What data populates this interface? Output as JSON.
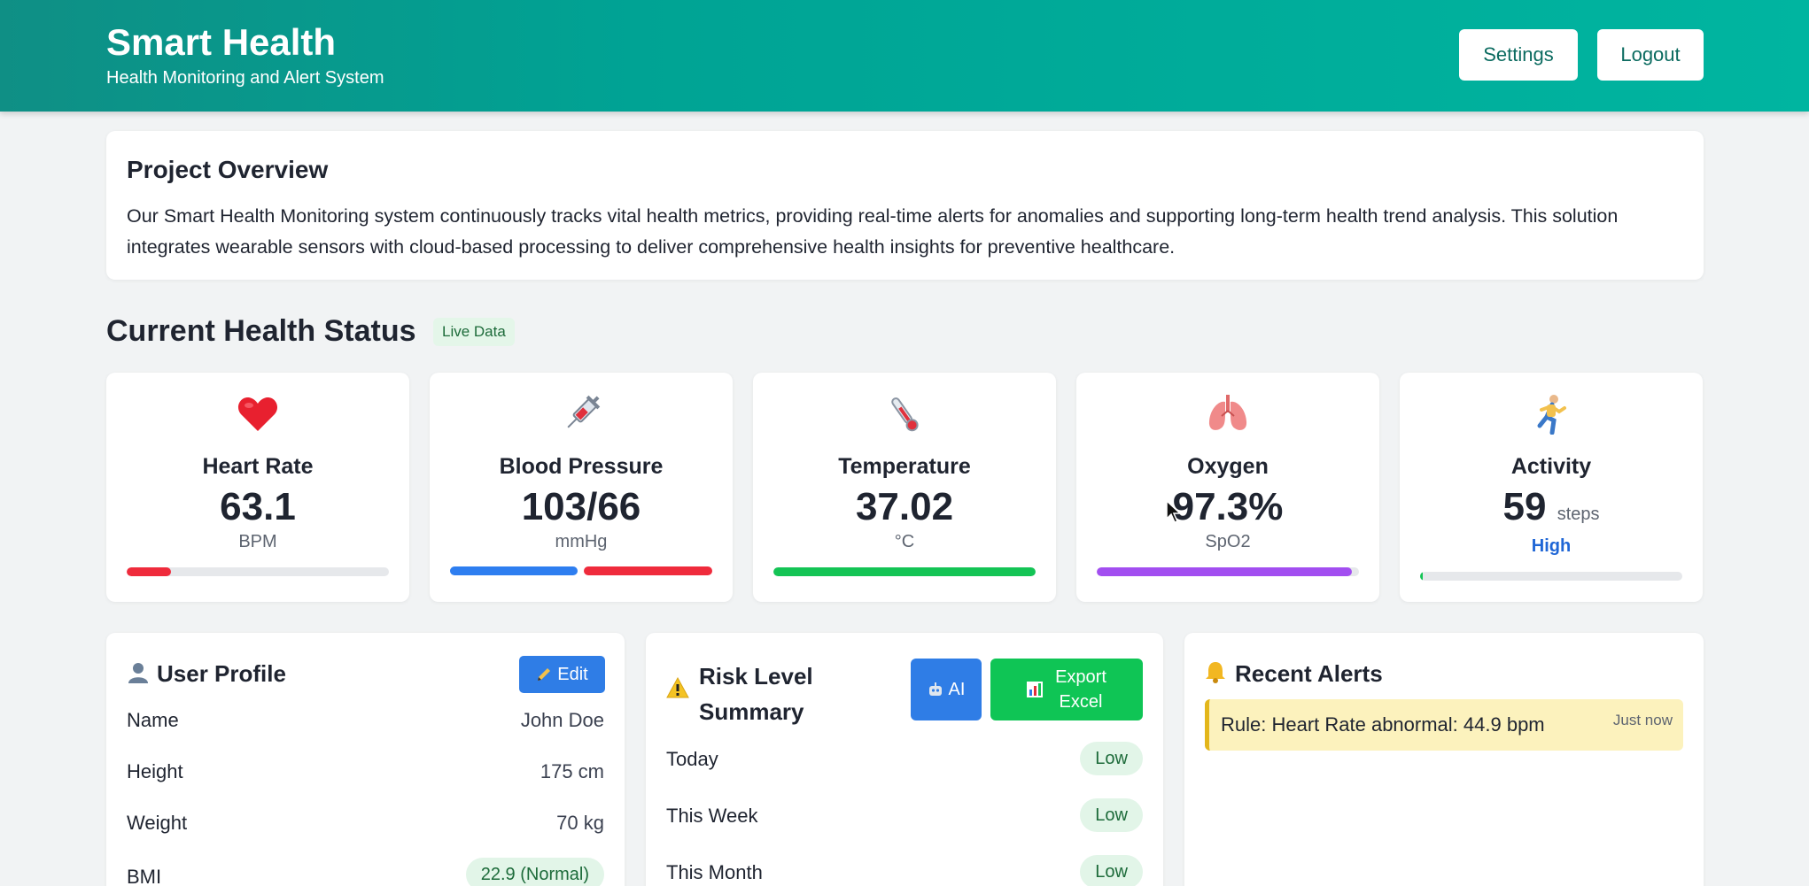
{
  "header": {
    "title": "Smart Health",
    "subtitle": "Health Monitoring and Alert System",
    "settings_label": "Settings",
    "logout_label": "Logout"
  },
  "overview": {
    "title": "Project Overview",
    "body": "Our Smart Health Monitoring system continuously tracks vital health metrics, providing real-time alerts for anomalies and supporting long-term health trend analysis. This solution integrates wearable sensors with cloud-based processing to deliver comprehensive health insights for preventive healthcare."
  },
  "status": {
    "title": "Current Health Status",
    "badge": "Live Data"
  },
  "metrics": [
    {
      "label": "Heart Rate",
      "value": "63.1",
      "unit": "BPM",
      "icon": "heart-icon",
      "bar_fraction": 0.17,
      "bar_color": "#ef2b3c"
    },
    {
      "label": "Blood Pressure",
      "value": "103/66",
      "unit": "mmHg",
      "icon": "syringe-icon",
      "bar_colors": [
        "#2e7ef0",
        "#ef2b3c"
      ]
    },
    {
      "label": "Temperature",
      "value": "37.02",
      "unit": "°C",
      "icon": "thermometer-icon",
      "bar_fraction": 1.0,
      "bar_color": "#14c455"
    },
    {
      "label": "Oxygen",
      "value": "97.3%",
      "unit": "SpO2",
      "icon": "lungs-icon",
      "bar_fraction": 0.973,
      "bar_color": "#a24ef0"
    },
    {
      "label": "Activity",
      "value": "59",
      "unit": "steps",
      "level": "High",
      "level_color": "#1f66d6",
      "icon": "runner-icon",
      "bar_fraction": 0.01,
      "bar_color": "#14c455"
    }
  ],
  "profile": {
    "title": "User Profile",
    "edit_label": "Edit",
    "rows": [
      {
        "label": "Name",
        "value": "John Doe"
      },
      {
        "label": "Height",
        "value": "175 cm"
      },
      {
        "label": "Weight",
        "value": "70 kg"
      },
      {
        "label": "BMI",
        "value": "22.9 (Normal)"
      }
    ]
  },
  "risk": {
    "title_line1": "Risk Level",
    "title_line2": "Summary",
    "ai_label": "AI",
    "export_line1": "Export",
    "export_line2": "Excel",
    "rows": [
      {
        "label": "Today",
        "value": "Low"
      },
      {
        "label": "This Week",
        "value": "Low"
      },
      {
        "label": "This Month",
        "value": "Low"
      }
    ]
  },
  "alerts": {
    "title": "Recent Alerts",
    "items": [
      {
        "text": "Rule: Heart Rate abnormal: 44.9 bpm",
        "time": "Just now"
      }
    ]
  }
}
